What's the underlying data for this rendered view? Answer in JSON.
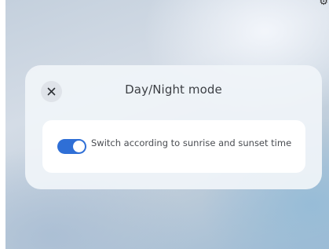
{
  "corner": {
    "glyph": "⚙"
  },
  "dialog": {
    "title": "Day/Night mode",
    "close_icon": "close-icon",
    "setting": {
      "label": "Switch according to sunrise and sunset time",
      "enabled": true
    }
  },
  "colors": {
    "toggle_on": "#2f6fd6",
    "dialog_bg": "#f0f4f9",
    "row_bg": "#ffffff"
  }
}
